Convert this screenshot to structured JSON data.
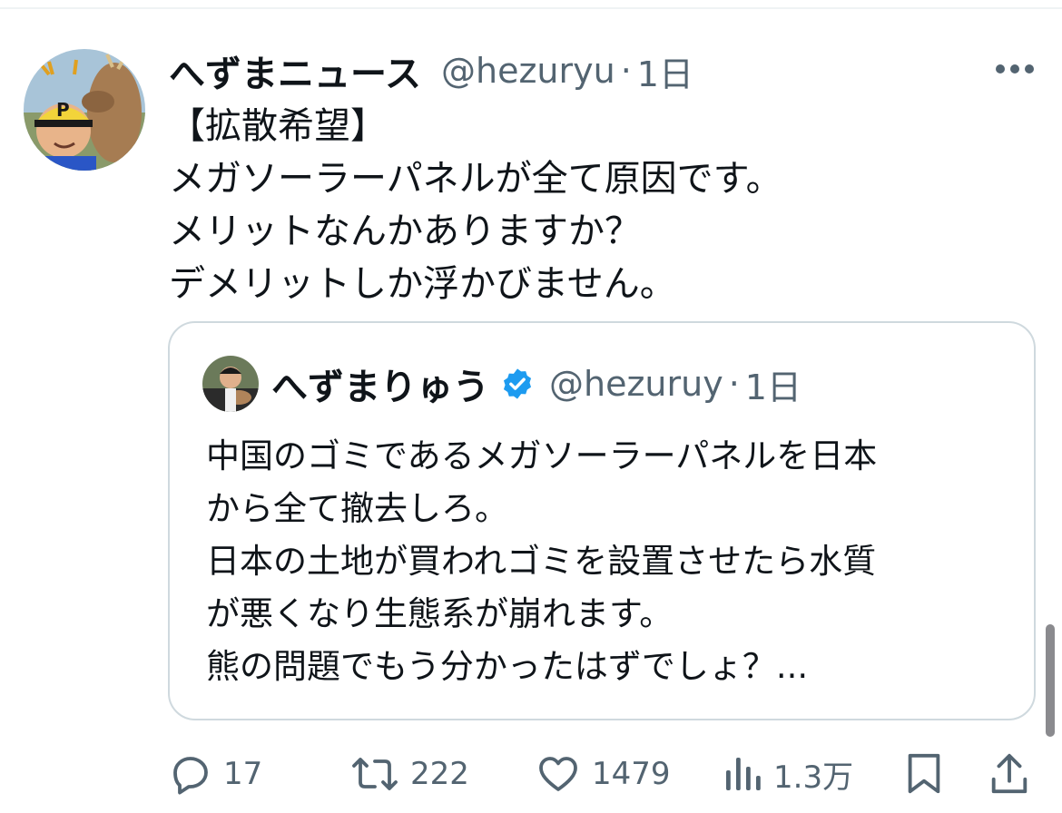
{
  "tweet": {
    "display_name": "へずまニュース",
    "handle": "@hezuryu",
    "separator": "·",
    "time": "1日",
    "avatar_icon": "user-avatar-deer-cap",
    "more_icon": "more-dots-icon",
    "text_lines": [
      "【拡散希望】",
      "メガソーラーパネルが全て原因です。",
      "メリットなんかありますか？",
      "デメリットしか浮かびません。"
    ]
  },
  "quote": {
    "display_name": "へずまりゅう",
    "handle": "@hezuruy",
    "separator": "·",
    "time": "1日",
    "verified_icon": "verified-badge-icon",
    "text_lines": [
      "中国のゴミであるメガソーラーパネルを日本",
      "から全て撤去しろ。",
      "日本の土地が買われゴミを設置させたら水質",
      "が悪くなり生態系が崩れます。",
      "熊の問題でもう分かったはずでしょ？..."
    ]
  },
  "actions": {
    "reply": {
      "icon": "reply-icon",
      "count": "17"
    },
    "retweet": {
      "icon": "retweet-icon",
      "count": "222"
    },
    "like": {
      "icon": "heart-icon",
      "count": "1479"
    },
    "views": {
      "icon": "views-chart-icon",
      "count": "1.3万"
    },
    "bookmark": {
      "icon": "bookmark-icon"
    },
    "share": {
      "icon": "share-icon"
    }
  },
  "colors": {
    "text_primary": "#0f1419",
    "text_secondary": "#536471",
    "border": "#cfd9de",
    "verified": "#1d9bf0"
  }
}
